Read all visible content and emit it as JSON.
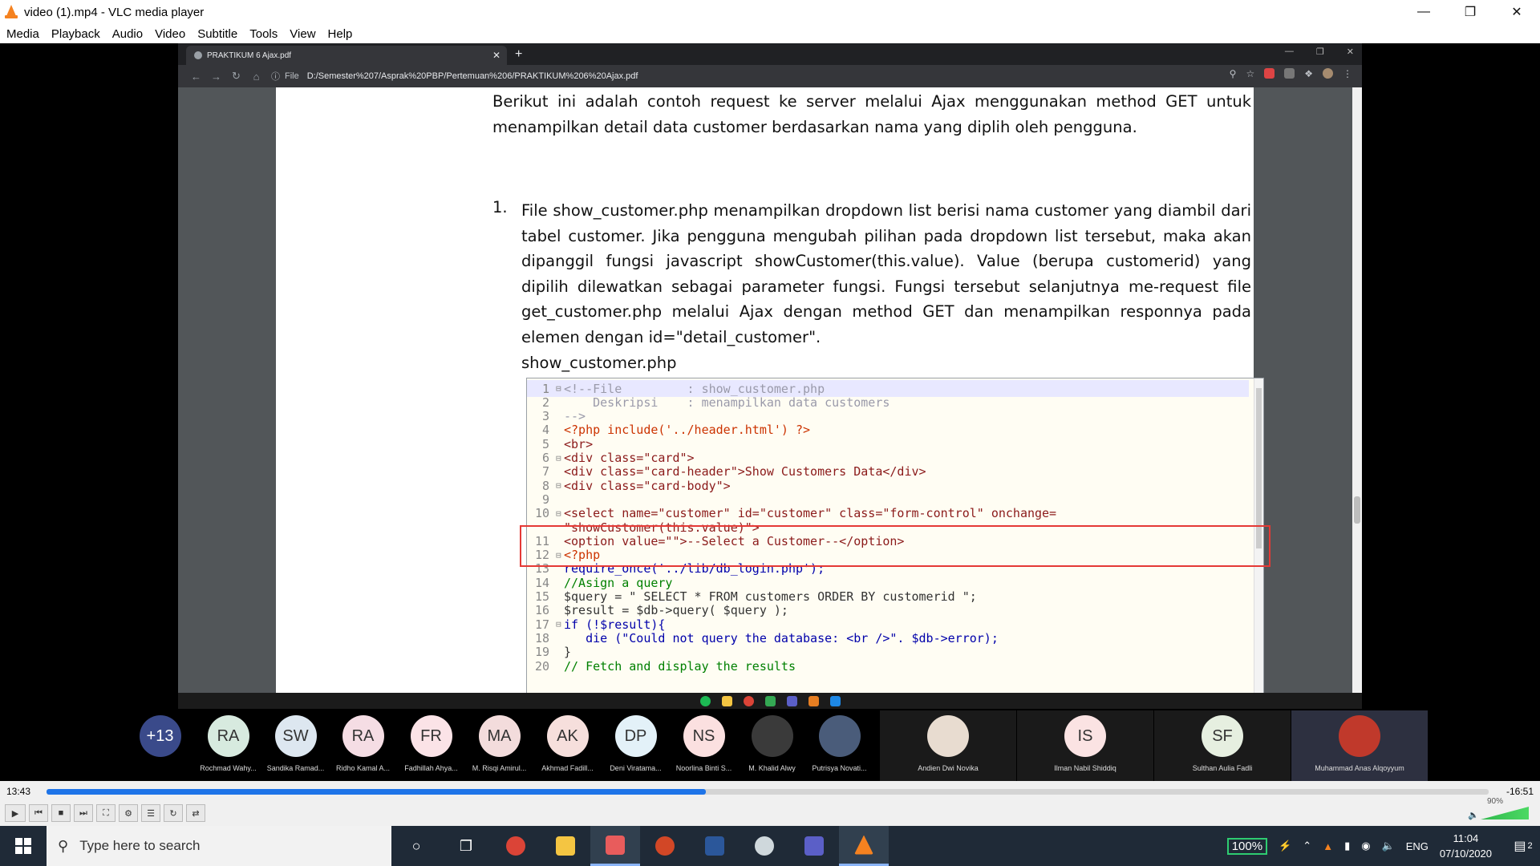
{
  "window": {
    "title": "video (1).mp4 - VLC media player"
  },
  "menu": [
    "Media",
    "Playback",
    "Audio",
    "Video",
    "Subtitle",
    "Tools",
    "View",
    "Help"
  ],
  "browser": {
    "tab_title": "PRAKTIKUM 6 Ajax.pdf",
    "address_prefix": "File",
    "url": "D:/Semester%207/Asprak%20PBP/Pertemuan%206/PRAKTIKUM%206%20Ajax.pdf"
  },
  "pdf": {
    "intro": "Berikut ini adalah contoh request ke server melalui Ajax menggunakan method GET untuk menampilkan detail data customer berdasarkan nama yang diplih oleh pengguna.",
    "item_number": "1.",
    "item_text": "File show_customer.php menampilkan dropdown list berisi nama customer yang diambil dari tabel customer. Jika pengguna mengubah pilihan pada dropdown list tersebut, maka akan dipanggil fungsi javascript showCustomer(this.value). Value (berupa customerid) yang dipilih dilewatkan sebagai parameter fungsi. Fungsi tersebut selanjutnya me-request file get_customer.php melalui Ajax dengan method GET dan menampilkan responnya pada elemen dengan id=\"detail_customer\".",
    "file_label": "show_customer.php",
    "code_lines": [
      {
        "n": "1",
        "fold": "⊟",
        "t": "<!--File         : show_customer.php"
      },
      {
        "n": "2",
        "fold": "",
        "t": "    Deskripsi    : menampilkan data customers"
      },
      {
        "n": "3",
        "fold": "",
        "t": "-->"
      },
      {
        "n": "4",
        "fold": "",
        "t": "<?php include('../header.html') ?>"
      },
      {
        "n": "5",
        "fold": "",
        "t": "<br>"
      },
      {
        "n": "6",
        "fold": "⊟",
        "t": "<div class=\"card\">"
      },
      {
        "n": "7",
        "fold": "",
        "t": "<div class=\"card-header\">Show Customers Data</div>"
      },
      {
        "n": "8",
        "fold": "⊟",
        "t": "<div class=\"card-body\">"
      },
      {
        "n": "9",
        "fold": "",
        "t": ""
      },
      {
        "n": "10",
        "fold": "⊟",
        "t": "<select name=\"customer\" id=\"customer\" class=\"form-control\" onchange="
      },
      {
        "n": "",
        "fold": "",
        "t": "\"showCustomer(this.value)\">"
      },
      {
        "n": "11",
        "fold": "",
        "t": "<option value=\"\">--Select a Customer--</option>"
      },
      {
        "n": "12",
        "fold": "⊟",
        "t": "<?php"
      },
      {
        "n": "13",
        "fold": "",
        "t": "require_once('../lib/db_login.php');"
      },
      {
        "n": "14",
        "fold": "",
        "t": "//Asign a query"
      },
      {
        "n": "15",
        "fold": "",
        "t": "$query = \" SELECT * FROM customers ORDER BY customerid \";"
      },
      {
        "n": "16",
        "fold": "",
        "t": "$result = $db->query( $query );"
      },
      {
        "n": "17",
        "fold": "⊟",
        "t": "if (!$result){"
      },
      {
        "n": "18",
        "fold": "",
        "t": "   die (\"Could not query the database: <br />\". $db->error);"
      },
      {
        "n": "19",
        "fold": "",
        "t": "}"
      },
      {
        "n": "20",
        "fold": "",
        "t": "// Fetch and display the results"
      }
    ]
  },
  "participants": [
    {
      "initials": "+13",
      "name": "",
      "color": "#3a4a8a",
      "fg": "#ffffff"
    },
    {
      "initials": "RA",
      "name": "Rochmad Wahy...",
      "color": "#d7eadf",
      "fg": "#333333"
    },
    {
      "initials": "SW",
      "name": "Sandika Ramad...",
      "color": "#dde7f0",
      "fg": "#333333"
    },
    {
      "initials": "RA",
      "name": "Ridho Kamal A...",
      "color": "#f5dde4",
      "fg": "#333333"
    },
    {
      "initials": "FR",
      "name": "Fadhillah Ahya...",
      "color": "#fbe3e7",
      "fg": "#333333"
    },
    {
      "initials": "MA",
      "name": "M. Risqi Amirul...",
      "color": "#f3dcdc",
      "fg": "#333333"
    },
    {
      "initials": "AK",
      "name": "Akhmad Fadill...",
      "color": "#f6dfdc",
      "fg": "#333333"
    },
    {
      "initials": "DP",
      "name": "Deni Viratama...",
      "color": "#e3f1f8",
      "fg": "#333333"
    },
    {
      "initials": "NS",
      "name": "Noorlina Binti S...",
      "color": "#fbe0e0",
      "fg": "#333333"
    },
    {
      "initials": "",
      "name": "M. Khalid Alwy",
      "color": "#3a3a3a",
      "fg": "#ffffff"
    },
    {
      "initials": "",
      "name": "Putrisya Novati...",
      "color": "#4a5c7a",
      "fg": "#ffffff"
    }
  ],
  "big_participants": [
    {
      "initials": "",
      "name": "Andien Dwi Novika",
      "color": "#e8dcd0"
    },
    {
      "initials": "IS",
      "name": "Ilman Nabil Shiddiq",
      "color": "#fbe3e3"
    },
    {
      "initials": "SF",
      "name": "Sulthan Aulia Fadli",
      "color": "#e6efe0"
    },
    {
      "initials": "",
      "name": "Muhammad Anas Alqoyyum",
      "color": "#c0392b"
    }
  ],
  "player": {
    "elapsed": "13:43",
    "remaining": "-16:51",
    "progress": 0.457,
    "volume_label": "90%",
    "volume": 0.9
  },
  "taskbar": {
    "search_placeholder": "Type here to search",
    "zoom": "100%",
    "lang": "ENG",
    "time": "11:04",
    "date": "07/10/2020",
    "notifications": "2"
  }
}
